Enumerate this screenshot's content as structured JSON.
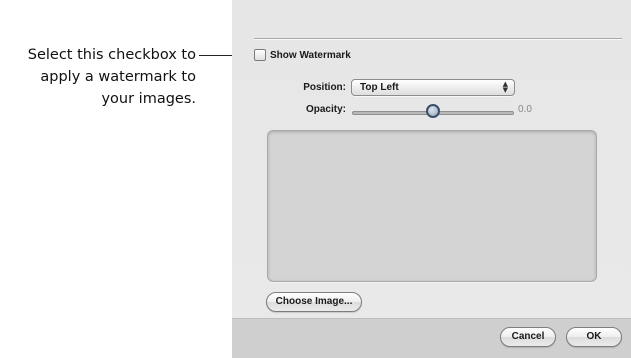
{
  "callout": {
    "line1": "Select this checkbox to",
    "line2": "apply a watermark to",
    "line3": "your images."
  },
  "dialog": {
    "show_watermark": {
      "label": "Show Watermark",
      "checked": false
    },
    "position": {
      "label": "Position:",
      "value": "Top Left",
      "arrows_icon": "up-down-arrows-icon"
    },
    "opacity": {
      "label": "Opacity:",
      "value": "0.0"
    },
    "choose_image_label": "Choose Image...",
    "cancel_label": "Cancel",
    "ok_label": "OK"
  }
}
